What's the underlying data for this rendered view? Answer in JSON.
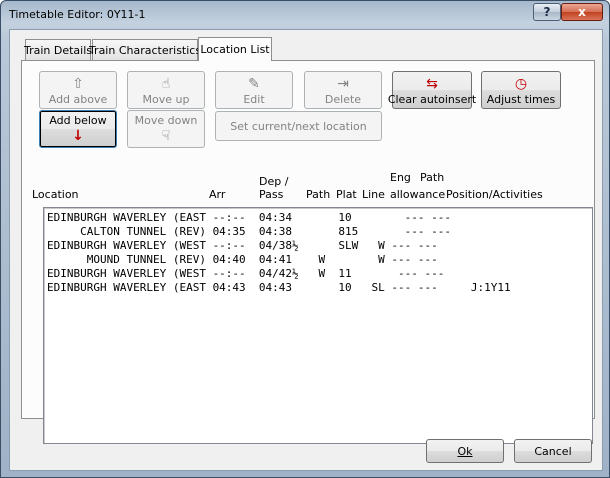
{
  "window": {
    "title": "Timetable Editor: 0Y11-1"
  },
  "titlebar": {
    "help_symbol": "?",
    "close_symbol": "x"
  },
  "tabs": [
    {
      "label": "Train Details",
      "active": false
    },
    {
      "label": "Train Characteristics",
      "active": false
    },
    {
      "label": "Location List",
      "active": true
    }
  ],
  "buttons": {
    "add_above": {
      "label": "Add above",
      "icon": "arrow-up-icon",
      "glyph": "⇧"
    },
    "move_up": {
      "label": "Move up",
      "icon": "hand-up-icon",
      "glyph": "☝"
    },
    "edit": {
      "label": "Edit",
      "icon": "edit-icon",
      "glyph": "✎"
    },
    "delete": {
      "label": "Delete",
      "icon": "delete-icon",
      "glyph": "⇥"
    },
    "clear_autoinsert": {
      "label": "Clear autoinsert",
      "icon": "clear-autoinsert-icon",
      "glyph": "⇆"
    },
    "adjust_times": {
      "label": "Adjust times",
      "icon": "clock-icon",
      "glyph": "◷"
    },
    "add_below": {
      "label": "Add below",
      "icon": "arrow-down-icon",
      "glyph": "↓"
    },
    "move_down": {
      "label": "Move down",
      "icon": "hand-down-icon",
      "glyph": "☟"
    },
    "set_current": {
      "label": "Set current/next location"
    }
  },
  "columns": {
    "location": "Location",
    "arr": "Arr",
    "dep_line1": "Dep /",
    "dep_line2": "Pass",
    "path": "Path",
    "plat": "Plat",
    "line": "Line",
    "eng_line1": "Eng",
    "eng_line2": "allowance",
    "path2_line1": "Path",
    "path2_line2": "allowance",
    "position": "Position/Activities"
  },
  "rows": [
    "EDINBURGH WAVERLEY (EAST --:--  04:34       10        --- ---",
    "     CALTON TUNNEL (REV) 04:35  04:38       815       --- ---",
    "EDINBURGH WAVERLEY (WEST --:--  04/38½      SLW   W --- ---",
    "      MOUND TUNNEL (REV) 04:40  04:41    W        W --- ---",
    "EDINBURGH WAVERLEY (WEST --:--  04/42½   W  11       --- ---",
    "EDINBURGH WAVERLEY (EAST 04:43  04:43       10   SL --- ---     J:1Y11"
  ],
  "footer": {
    "ok": "Ok",
    "cancel": "Cancel"
  },
  "colors": {
    "accent_red": "#c00000",
    "focus_blue": "#3c7fb1"
  }
}
